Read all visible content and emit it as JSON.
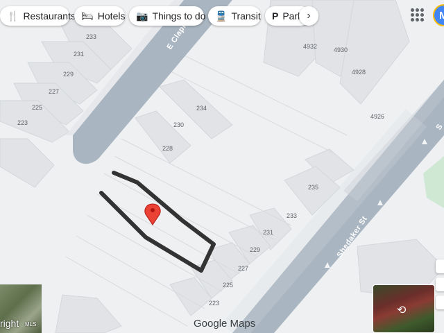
{
  "chips": [
    {
      "label": "Restaurants",
      "icon": "fork-knife-icon"
    },
    {
      "label": "Hotels",
      "icon": "bed-icon"
    },
    {
      "label": "Things to do",
      "icon": "camera-icon"
    },
    {
      "label": "Transit",
      "icon": "train-icon"
    },
    {
      "label": "Park",
      "icon": "parking-icon"
    }
  ],
  "more_icon": "chevron-right-icon",
  "apps_icon": "apps-grid-icon",
  "avatar_letter": "M",
  "streets": {
    "clapier": "E Clapier St",
    "shedaker": "Shedaker St",
    "edge": "S"
  },
  "house_numbers": {
    "h233a": "233",
    "h231a": "231",
    "h229a": "229",
    "h227a": "227",
    "h225a": "225",
    "h223a": "223",
    "h234": "234",
    "h230": "230",
    "h228": "228",
    "h4932": "4932",
    "h4930": "4930",
    "h4928": "4928",
    "h4926": "4926",
    "h235": "235",
    "h233b": "233",
    "h231b": "231",
    "h229b": "229",
    "h227b": "227",
    "h225b": "225",
    "h223b": "223"
  },
  "branding": {
    "google": "Google",
    "maps": "Maps"
  },
  "satellite_label": "right",
  "satellite_sub": "MLS",
  "colors": {
    "road": "#a8b4c0",
    "building": "#e3e5e8",
    "pin": "#ea4335",
    "annotation": "#333333",
    "park": "#cfe8d4"
  }
}
